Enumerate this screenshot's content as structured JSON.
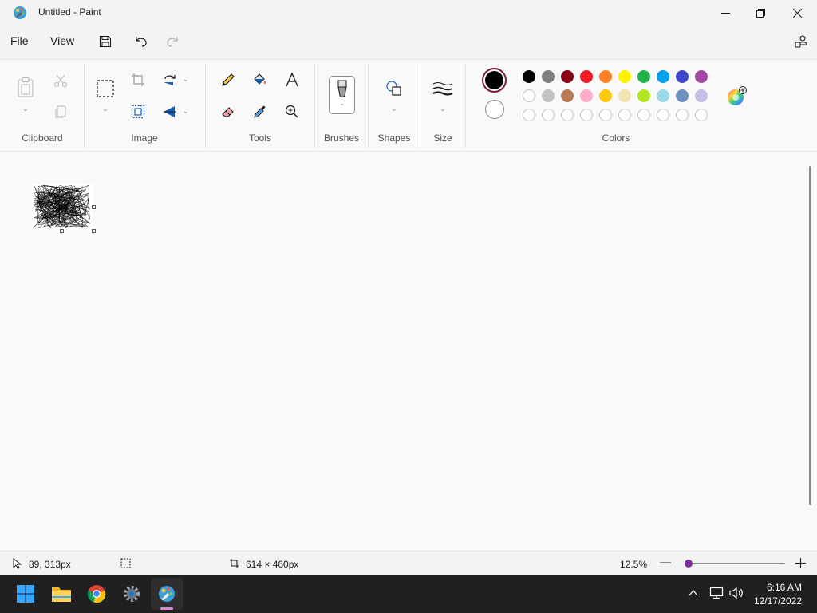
{
  "window": {
    "title": "Untitled - Paint",
    "icon": "paint-palette-icon"
  },
  "menu": {
    "file": "File",
    "view": "View"
  },
  "ribbon": {
    "groups": {
      "clipboard": "Clipboard",
      "image": "Image",
      "tools": "Tools",
      "brushes": "Brushes",
      "shapes": "Shapes",
      "size": "Size",
      "colors": "Colors"
    },
    "primary_color": "#000000",
    "secondary_color": "#ffffff",
    "palette_row1": [
      "#000000",
      "#7f7f7f",
      "#880015",
      "#ed1c24",
      "#ff7f27",
      "#fff200",
      "#22b14c",
      "#00a2e8",
      "#3f48cc",
      "#a349a4"
    ],
    "palette_row2": [
      "#ffffff",
      "#c3c3c3",
      "#b97a57",
      "#ffaec9",
      "#ffc90e",
      "#efe4b0",
      "#b5e61d",
      "#99d9ea",
      "#7092be",
      "#c8bfe7"
    ],
    "palette_row3_empty_slots": 10
  },
  "status": {
    "cursor_pos": "89, 313px",
    "canvas_size": "614 × 460px",
    "zoom": "12.5%",
    "zoom_slider_fraction": 0.0
  },
  "taskbar": {
    "time": "6:16 AM",
    "date": "12/17/2022",
    "apps": [
      "start-icon",
      "file-explorer-icon",
      "chrome-icon",
      "settings-icon",
      "paint-icon"
    ],
    "active_app": "paint-icon"
  }
}
